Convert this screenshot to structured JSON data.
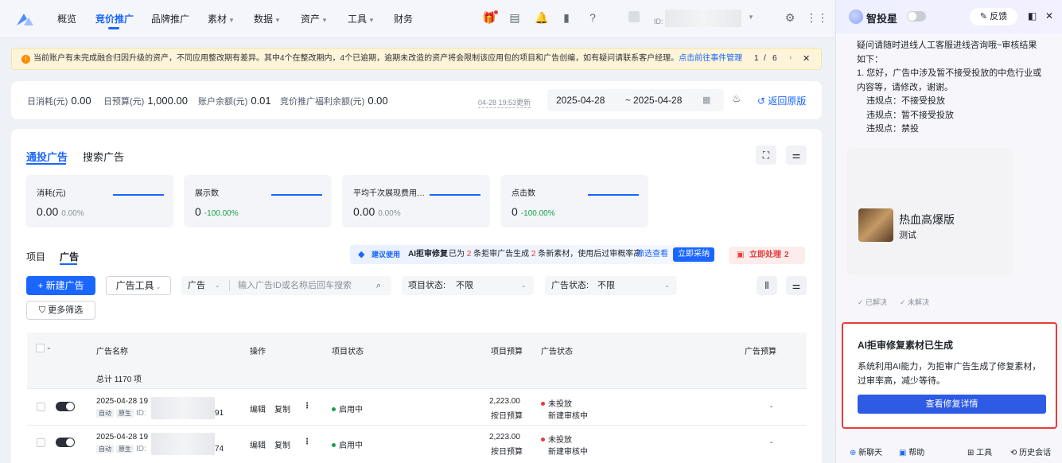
{
  "nav": {
    "items": [
      "概览",
      "竞价推广",
      "品牌推广",
      "素材",
      "数据",
      "资产",
      "工具",
      "财务"
    ],
    "active_index": 1,
    "account_id_label": "ID:"
  },
  "banner": {
    "text": "当前账户有未完成融合归因升级的资产，不同应用整改期有差异。其中4个在整改期内，4个已逾期，逾期未改造的资产将会限制该应用包的项目和广告创编，如有疑问请联系客户经理。",
    "link": "点击前往事件管理",
    "page": "1",
    "slash": "/",
    "total": "6"
  },
  "stats": {
    "daily_spend_label": "日消耗(元)",
    "daily_spend": "0.00",
    "daily_budget_label": "日预算(元)",
    "daily_budget": "1,000.00",
    "balance_label": "账户余额(元)",
    "balance": "0.01",
    "welfare_label": "竞价推广福利余额(元)",
    "welfare": "0.00",
    "updated": "04-28 19:53更新",
    "date_start": "2025-04-28",
    "date_sep": "~",
    "date_end": "2025-04-28",
    "back_label": "返回原版"
  },
  "main": {
    "tabs": [
      "通投广告",
      "搜索广告"
    ],
    "metrics": [
      {
        "label": "消耗(元)",
        "value": "0.00",
        "pct": "0.00%",
        "pct_color": "gray"
      },
      {
        "label": "展示数",
        "value": "0",
        "pct": "-100.00%",
        "pct_color": "green"
      },
      {
        "label": "平均千次展现费用…",
        "value": "0.00",
        "pct": "0.00%",
        "pct_color": "gray"
      },
      {
        "label": "点击数",
        "value": "0",
        "pct": "-100.00%",
        "pct_color": "green"
      }
    ],
    "subtabs": [
      "项目",
      "广告"
    ],
    "suggest": {
      "badge": "建议使用",
      "title": "AI拒审修复",
      "text_pre": "已为",
      "n1": "2",
      "text_mid": "条拒审广告生成",
      "n2": "2",
      "text_post": "条新素材，使用后过审概率高",
      "link": "筛选查看",
      "btn": "立即采纳"
    },
    "handle": {
      "label": "立即处理",
      "count": "2"
    },
    "toolbar": {
      "new_ad": "+ 新建广告",
      "ad_tools": "广告工具",
      "search_scope": "广告",
      "search_placeholder": "输入广告ID或名称后回车搜索",
      "proj_status_label": "项目状态:",
      "proj_status": "不限",
      "ad_status_label": "广告状态:",
      "ad_status": "不限",
      "more_filter": "更多筛选"
    },
    "table": {
      "headers": [
        "广告名称",
        "操作",
        "项目状态",
        "项目预算",
        "广告状态",
        "广告预算"
      ],
      "total": "总计 1170 项",
      "rows": [
        {
          "time": "2025-04-28 19",
          "tags": [
            "自动",
            "原生"
          ],
          "id_label": "ID:",
          "id_tail": "91",
          "ops": [
            "编辑",
            "复制"
          ],
          "proj_status": "启用中",
          "budget": "2,223.00",
          "budget_type": "按日预算",
          "ad_status": "未投放",
          "ad_sub": "新建审核中",
          "ad_budget": "-"
        },
        {
          "time": "2025-04-28 19",
          "tags": [
            "自动",
            "原生"
          ],
          "id_label": "ID:",
          "id_tail": "74",
          "ops": [
            "编辑",
            "复制"
          ],
          "proj_status": "启用中",
          "budget": "2,223.00",
          "budget_type": "按日预算",
          "ad_status": "未投放",
          "ad_sub": "新建审核中",
          "ad_budget": "-"
        }
      ]
    }
  },
  "panel": {
    "title": "智投星",
    "feedback": "反馈",
    "msg_lines": [
      "疑问请随时进线人工客服进线咨询哦~审核结果",
      "如下：",
      "1. 您好，广告中涉及暂不接受投放的中危行业或",
      "内容等，请修改，谢谢。",
      "违规点：不接受投放",
      "违规点：暂不接受投放",
      "违规点：禁投"
    ],
    "preview_title": "热血高爆版",
    "preview_sub": "测试",
    "resolved": "已解决",
    "unresolved": "未解决",
    "card": {
      "title": "AI拒审修复素材已生成",
      "desc1": "系统利用AI能力，为拒审广告生成了修复素材，",
      "desc2": "过审率高，减少等待。",
      "btn": "查看修复详情"
    },
    "bottom": [
      "新聊天",
      "帮助",
      "工具",
      "历史会话"
    ]
  },
  "colors": {
    "accent": "#1a66ff",
    "danger": "#e83b3b",
    "success": "#15a24a"
  }
}
